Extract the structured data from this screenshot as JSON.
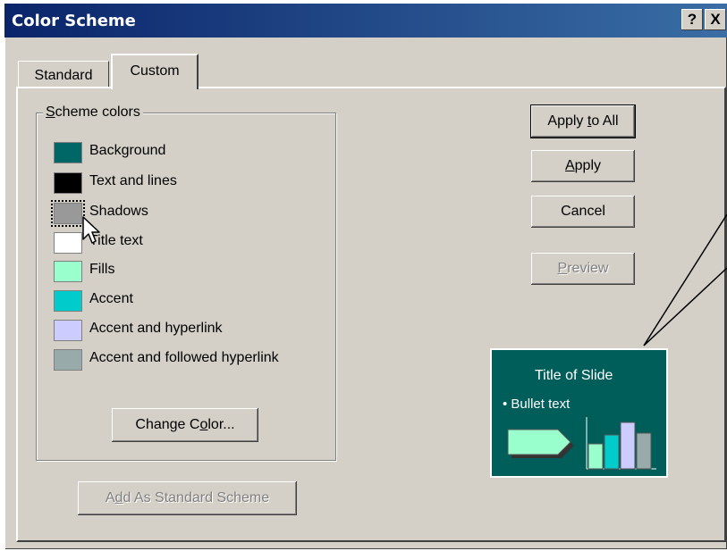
{
  "window": {
    "title": "Color Scheme",
    "help_label": "?",
    "close_label": "X"
  },
  "tabs": [
    {
      "label": "Standard",
      "active": false
    },
    {
      "label": "Custom",
      "active": true
    }
  ],
  "scheme_group": {
    "legend_accel": "S",
    "legend_rest": "cheme colors",
    "items": [
      {
        "label": "Background",
        "color": "#006666"
      },
      {
        "label": "Text and lines",
        "color": "#000000"
      },
      {
        "label": "Shadows",
        "color": "#999999",
        "selected": true
      },
      {
        "label": "Title text",
        "color": "#ffffff"
      },
      {
        "label": "Fills",
        "color": "#99ffcc"
      },
      {
        "label": "Accent",
        "color": "#00cccc"
      },
      {
        "label": "Accent and hyperlink",
        "color": "#ccccff"
      },
      {
        "label": "Accent and followed hyperlink",
        "color": "#99aaaa"
      }
    ],
    "change_color": {
      "pre": "Change C",
      "accel": "o",
      "post": "lor..."
    }
  },
  "buttons": {
    "apply_to_all": {
      "pre": "Apply ",
      "accel": "t",
      "post": "o All"
    },
    "apply": {
      "pre": "",
      "accel": "A",
      "post": "pply"
    },
    "cancel": {
      "label": "Cancel"
    },
    "preview": {
      "pre": "",
      "accel": "P",
      "post": "review"
    },
    "add_standard": {
      "pre": "A",
      "accel": "d",
      "post": "d As Standard Scheme"
    }
  },
  "sample": {
    "title": "Title of Slide",
    "bullet": "• Bullet text",
    "bg_color": "#005e5a",
    "fill_color": "#99ffcc",
    "accent_color": "#00cccc",
    "hyperlink_color": "#ccccff",
    "followed_color": "#99aaaa"
  }
}
